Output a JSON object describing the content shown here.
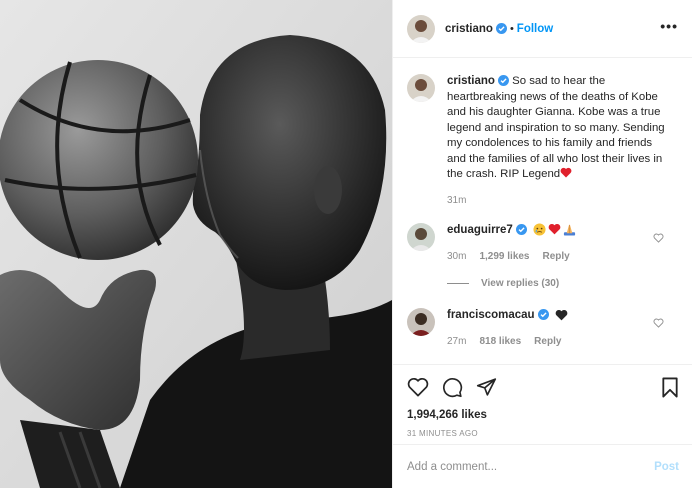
{
  "header": {
    "username": "cristiano",
    "dot": "•",
    "follow_label": "Follow",
    "more_label": "•••"
  },
  "caption": {
    "username": "cristiano",
    "text": "So sad to hear the heartbreaking news of the deaths of Kobe and his daughter Gianna. Kobe was a true legend and inspiration to so many. Sending my condolences to his family and friends and the families of all who lost their lives in the crash. RIP Legend",
    "time": "31m"
  },
  "comments": [
    {
      "username": "eduaguirre7",
      "time": "30m",
      "likes": "1,299 likes",
      "reply_label": "Reply",
      "view_replies": "View replies (30)"
    },
    {
      "username": "franciscomacau",
      "time": "27m",
      "likes": "818 likes",
      "reply_label": "Reply"
    }
  ],
  "actions": {
    "likes": "1,994,266 likes",
    "timestamp": "31 MINUTES AGO"
  },
  "add_comment": {
    "placeholder": "Add a comment...",
    "post_label": "Post"
  },
  "colors": {
    "link_blue": "#0095f6",
    "post_disabled": "#b2dffc",
    "muted": "#8e8e8e",
    "verified": "#3897f0",
    "heart_red": "#e0202c"
  }
}
